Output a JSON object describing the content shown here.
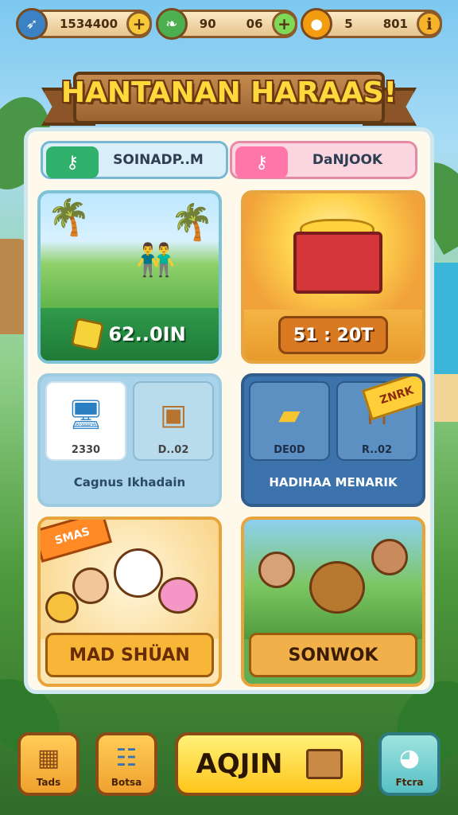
{
  "resources": [
    {
      "icon": "rocket-icon",
      "value": "1534400",
      "extra": "",
      "color": "#3b82c4"
    },
    {
      "icon": "leaf-icon",
      "value": "90",
      "extra": "06",
      "color": "#4caf50"
    },
    {
      "icon": "balloon-icon",
      "value": "5",
      "extra": "801",
      "color": "#f39c12"
    }
  ],
  "title": "HANTANAN HARAAS!",
  "tabs": [
    {
      "label": "SOINADP..M",
      "icon": "key-icon"
    },
    {
      "label": "DaNJOOK",
      "icon": "key-icon"
    }
  ],
  "cards": {
    "card1": {
      "price": "62..0IN"
    },
    "card2": {
      "price": "51 : 20T"
    },
    "card3": {
      "items": [
        {
          "caption": "2330"
        },
        {
          "caption": "D..02"
        }
      ],
      "footer": "Cagnus Ikhadain"
    },
    "card4": {
      "items": [
        {
          "caption": "DE0D"
        },
        {
          "caption": "R..02"
        }
      ],
      "footer": "HADIHAA MENARIK",
      "ribbon": "ZNRK"
    },
    "card5": {
      "label": "MAD SHÜAN",
      "ribbon": "SMAS"
    },
    "card6": {
      "label": "SONWOK"
    }
  },
  "bottom_nav": {
    "left1": "Tads",
    "left2": "Botsa",
    "main": "AQJIN",
    "right": "Ftcra"
  }
}
